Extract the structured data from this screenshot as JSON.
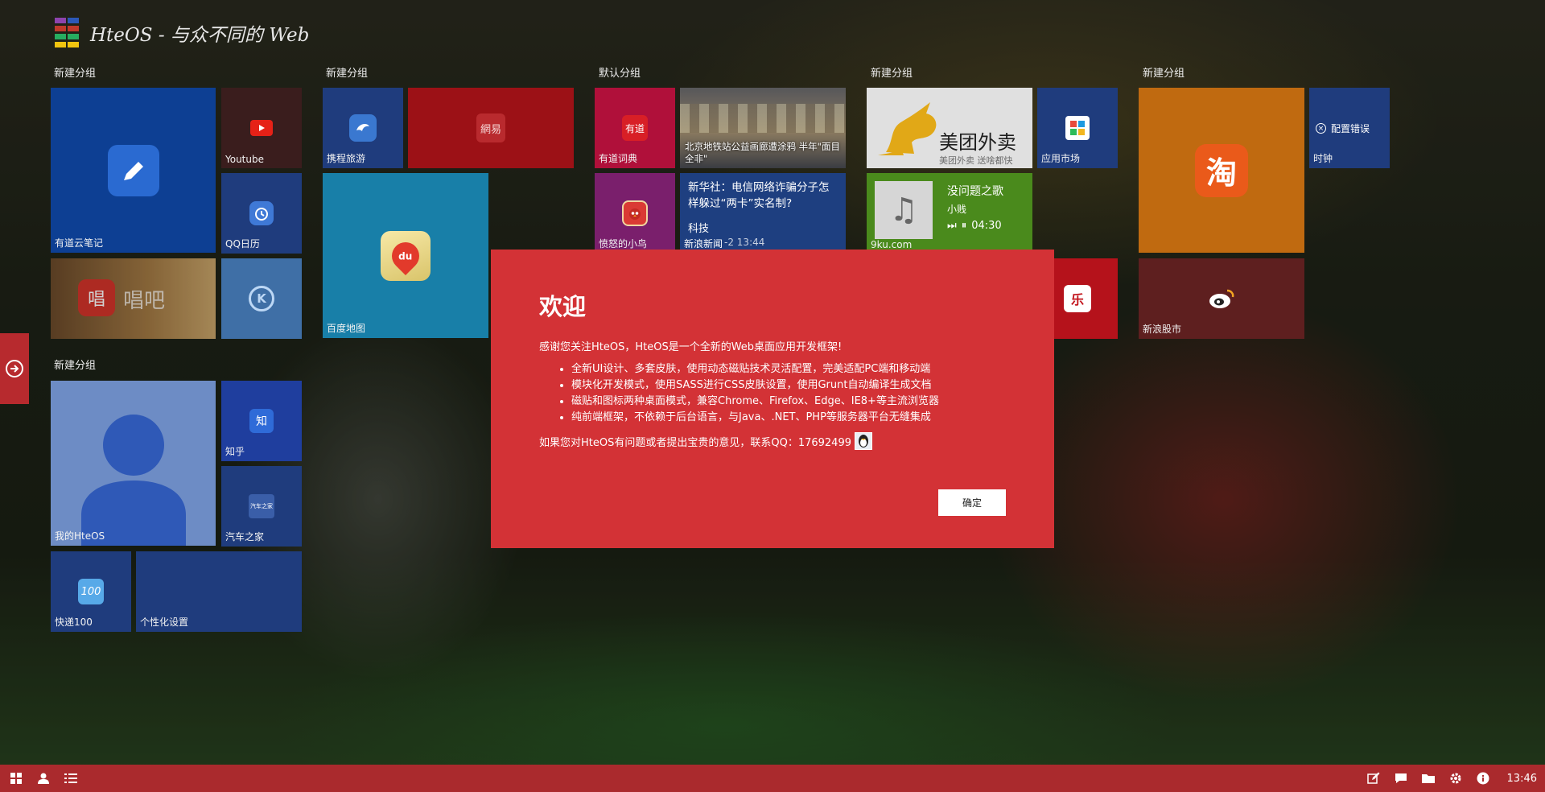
{
  "app": {
    "brand": "HteOS - 与众不同的 Web"
  },
  "groups": [
    {
      "title": "新建分组"
    },
    {
      "title": "新建分组"
    },
    {
      "title": "默认分组"
    },
    {
      "title": "新建分组"
    },
    {
      "title": "新建分组"
    },
    {
      "title": "新建分组"
    }
  ],
  "tiles": {
    "youdao_note": "有道云笔记",
    "youtube": "Youtube",
    "qq_calendar": "QQ日历",
    "changba": "唱吧",
    "ctrip": "携程旅游",
    "netease": "網易",
    "baidu_map": "百度地图",
    "youdao_dict": "有道词典",
    "youdao_dict_logo": "有道",
    "bj_news_caption": "北京地铁站公益画廊遭涂鸦 半年\"面目全非\"",
    "angry_birds": "愤怒的小鸟",
    "sina_news_title": "新华社：电信网络诈骗分子怎样躲过“两卡”实名制?",
    "sina_news_category": "科技",
    "sina_news_source": "新浪新闻",
    "sina_news_time": "-2 13:44",
    "meituan": "美团外卖",
    "meituan_sub": "美团外卖  送啥都快",
    "app_market": "应用市场",
    "music_title": "没问题之歌",
    "music_artist": "小贱",
    "music_time": "04:30",
    "music_site": "9ku.com",
    "taobao": "淘",
    "clock_label": "时钟",
    "clock_error": "配置错误",
    "sina_stock": "新浪股市",
    "my_hteos": "我的HteOS",
    "zhihu": "知乎",
    "zhihu_logo": "知",
    "autohome": "汽车之家",
    "autohome_logo": "汽车之家",
    "kuaidi": "快递100",
    "personalize": "个性化设置",
    "baidu_du": "du"
  },
  "dialog": {
    "title": "欢迎",
    "intro": "感谢您关注HteOS，HteOS是一个全新的Web桌面应用开发框架!",
    "bullets": [
      "全新UI设计、多套皮肤，使用动态磁贴技术灵活配置，完美适配PC端和移动端",
      "模块化开发模式，使用SASS进行CSS皮肤设置，使用Grunt自动编译生成文档",
      "磁贴和图标两种桌面模式，兼容Chrome、Firefox、Edge、IE8+等主流浏览器",
      "纯前端框架，不依赖于后台语言，与Java、.NET、PHP等服务器平台无缝集成"
    ],
    "contact": "如果您对HteOS有问题或者提出宝贵的意见，联系QQ：17692499",
    "ok": "确定"
  },
  "taskbar": {
    "clock": "13:46"
  },
  "colors": {
    "accent": "#d33236",
    "taskbar": "#aa2a2d",
    "tile_blue": "#0d3f93",
    "tile_navy": "#1f3c7d",
    "tile_red": "#9c1116",
    "tile_orange": "#c06a10",
    "tile_green": "#4a8a1c"
  }
}
